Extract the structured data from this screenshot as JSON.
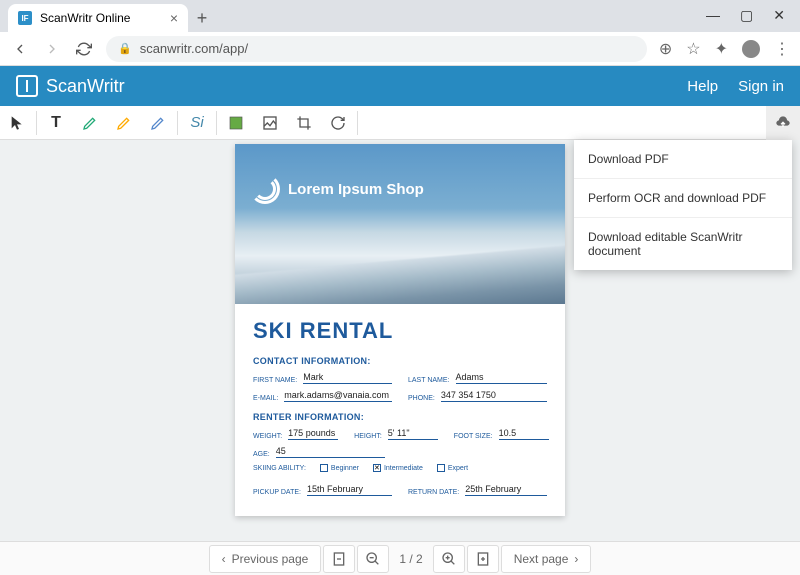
{
  "browser": {
    "tab_title": "ScanWritr Online",
    "url": "scanwritr.com/app/"
  },
  "header": {
    "app_name": "ScanWritr",
    "help": "Help",
    "signin": "Sign in"
  },
  "menu": {
    "item1": "Download PDF",
    "item2": "Perform OCR and download PDF",
    "item3": "Download editable ScanWritr document"
  },
  "doc": {
    "hero_brand": "Lorem Ipsum Shop",
    "title": "SKI RENTAL",
    "sec1": "CONTACT INFORMATION:",
    "first_name_lbl": "FIRST NAME:",
    "first_name": "Mark",
    "last_name_lbl": "LAST NAME:",
    "last_name": "Adams",
    "email_lbl": "E-MAIL:",
    "email": "mark.adams@vanaia.com",
    "phone_lbl": "PHONE:",
    "phone": "347 354 1750",
    "sec2": "RENTER  INFORMATION:",
    "weight_lbl": "WEIGHT:",
    "weight": "175 pounds",
    "height_lbl": "HEIGHT:",
    "height": "5' 11\"",
    "foot_lbl": "FOOT SIZE:",
    "foot": "10.5",
    "age_lbl": "AGE:",
    "age": "45",
    "ability_lbl": "SKIING ABILITY:",
    "chk1": "Beginner",
    "chk2": "Intermediate",
    "chk3": "Expert",
    "pickup_lbl": "PICKUP DATE:",
    "pickup": "15th February",
    "return_lbl": "RETURN DATE:",
    "return": "25th February"
  },
  "footer": {
    "prev": "Previous page",
    "next": "Next page",
    "page": "1 / 2"
  }
}
